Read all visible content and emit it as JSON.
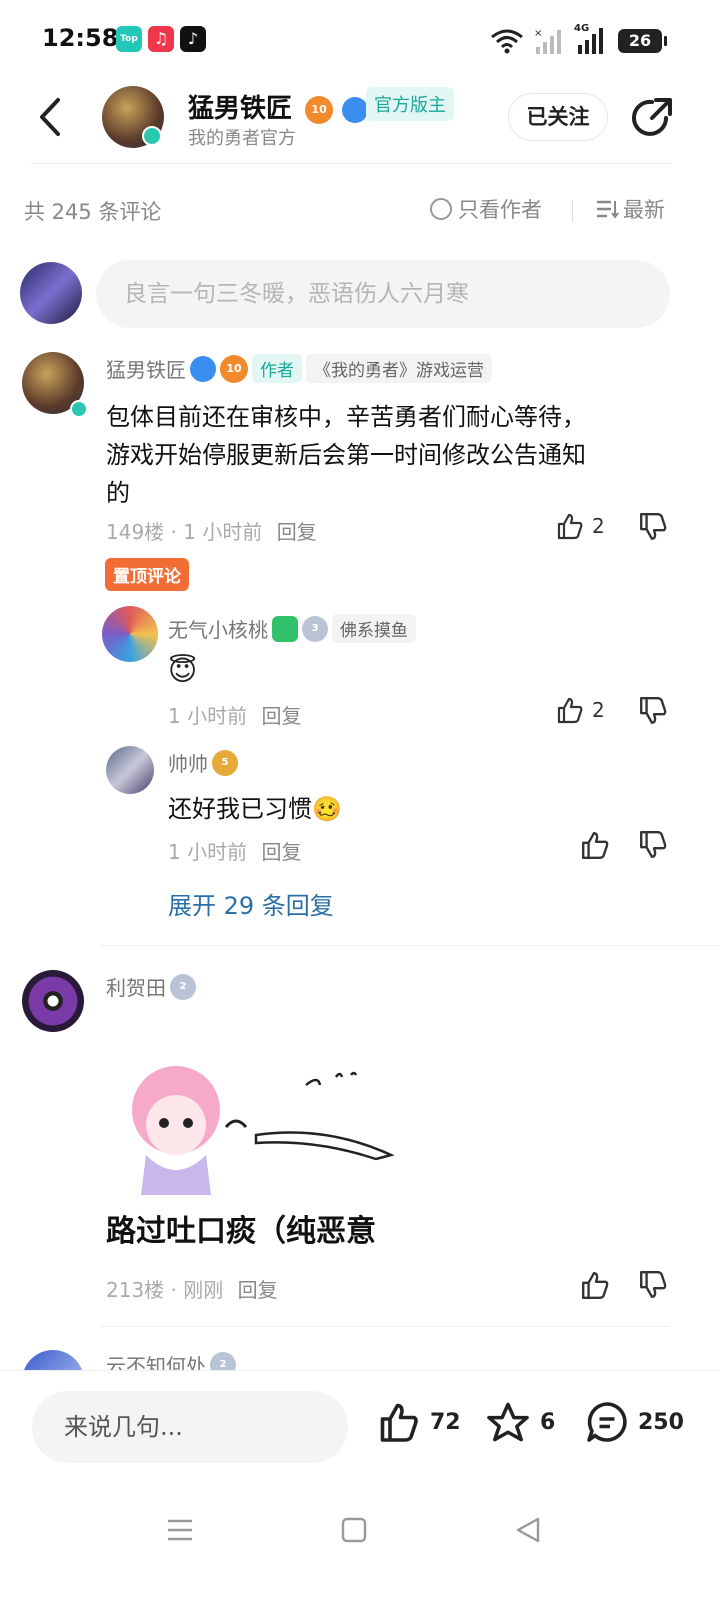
{
  "status_bar": {
    "time": "12:58",
    "app_badges": [
      {
        "name": "top-app-icon",
        "label": "Top",
        "color": "#22c7b8"
      },
      {
        "name": "music-app-icon",
        "label": "♫",
        "color": "#f0364b"
      },
      {
        "name": "tiktok-app-icon",
        "label": "♪",
        "color": "#111111"
      }
    ],
    "network_label": "4G",
    "battery": "26"
  },
  "header": {
    "title": "猛男铁匠",
    "level": "10",
    "official_tag": "官方版主",
    "subtitle": "我的勇者官方",
    "follow_label": "已关注"
  },
  "toolbar": {
    "comment_count": "共 245 条评论",
    "author_only_label": "只看作者",
    "sort_label": "最新"
  },
  "composer": {
    "placeholder": "良言一句三冬暖，恶语伤人六月寒"
  },
  "comments": [
    {
      "user": "猛男铁匠",
      "level": "10",
      "author_tag": "作者",
      "game_tag": "《我的勇者》游戏运营",
      "text_lines": [
        "包体目前还在审核中，辛苦勇者们耐心等待，",
        "游戏开始停服更新后会第一时间修改公告通知",
        "的"
      ],
      "meta": "149楼 · 1 小时前",
      "reply_label": "回复",
      "likes": "2",
      "pinned_label": "置顶评论",
      "replies": [
        {
          "user": "无气小核桃",
          "level": "3",
          "tag": "佛系摸鱼",
          "emoji": "😇",
          "meta": "1 小时前",
          "reply_label": "回复",
          "likes": "2"
        },
        {
          "user": "帅帅",
          "level": "5",
          "text": "还好我已习惯",
          "emoji": "🥴",
          "meta": "1 小时前",
          "reply_label": "回复"
        }
      ],
      "expand_label": "展开 29 条回复"
    },
    {
      "user": "利贺田",
      "level": "2",
      "text": "路过吐口痰（纯恶意",
      "meta": "213楼 · 刚刚",
      "reply_label": "回复"
    },
    {
      "user": "云不知何处",
      "level": "2"
    }
  ],
  "bottom_bar": {
    "input_placeholder": "来说几句...",
    "likes": "72",
    "favorites": "6",
    "comments": "250"
  },
  "colors": {
    "accent_teal": "#19a99a",
    "link_blue": "#2a6fa8",
    "pinned_orange": "#f26d33"
  }
}
